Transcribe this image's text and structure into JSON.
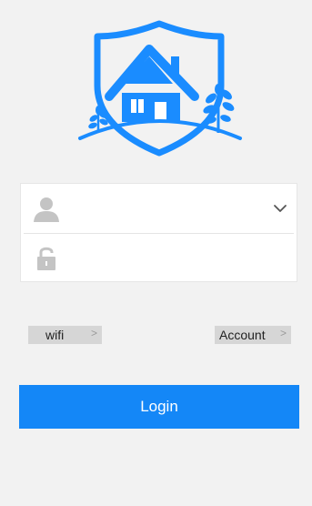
{
  "app": {
    "logo_icon": "shield-house-icon",
    "accent_color": "#1487f7"
  },
  "form": {
    "username": {
      "value": "",
      "placeholder": "",
      "icon": "user-icon",
      "dropdown_icon": "chevron-down-icon"
    },
    "password": {
      "value": "",
      "placeholder": "",
      "icon": "lock-icon"
    }
  },
  "links": {
    "wifi_label": "wifi",
    "wifi_chevron": ">",
    "account_label": "Account",
    "account_chevron": ">"
  },
  "login": {
    "label": "Login"
  }
}
